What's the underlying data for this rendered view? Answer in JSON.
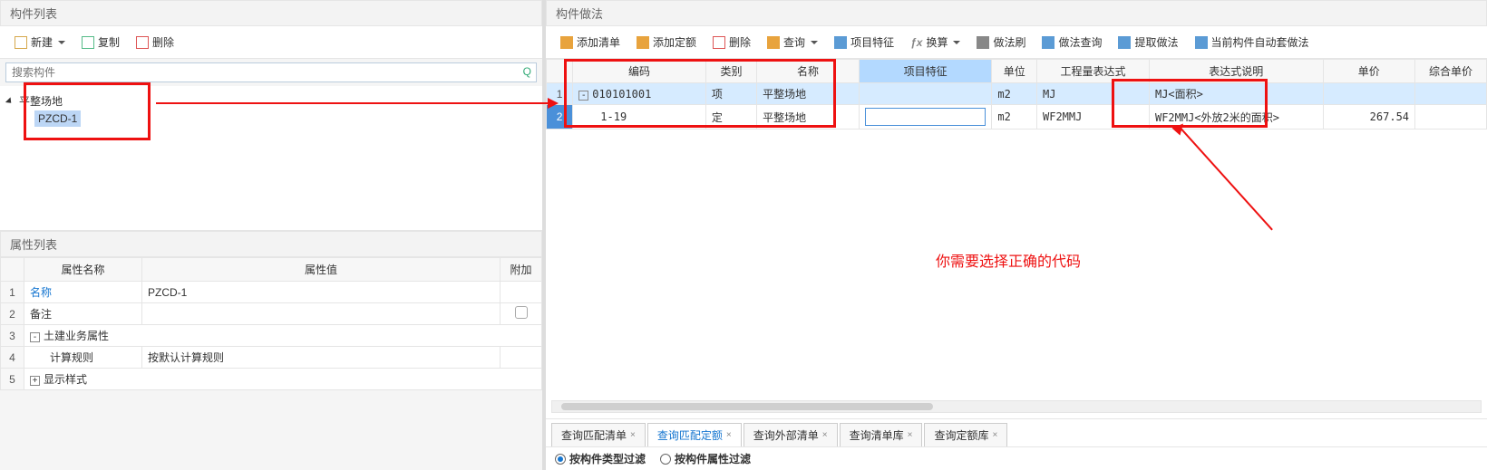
{
  "left": {
    "title": "构件列表",
    "toolbar": {
      "new": "新建",
      "copy": "复制",
      "delete": "删除"
    },
    "search_placeholder": "搜索构件",
    "tree": {
      "root": "平整场地",
      "child": "PZCD-1"
    },
    "attr_title": "属性列表",
    "attr_headers": {
      "name": "属性名称",
      "value": "属性值",
      "extra": "附加"
    },
    "attr_rows": [
      {
        "n": "1",
        "name": "名称",
        "value": "PZCD-1",
        "blue": true
      },
      {
        "n": "2",
        "name": "备注",
        "value": "",
        "check": true
      },
      {
        "n": "3",
        "name": "土建业务属性",
        "exp": "-",
        "span": true
      },
      {
        "n": "4",
        "name": "计算规则",
        "value": "按默认计算规则",
        "indent": true
      },
      {
        "n": "5",
        "name": "显示样式",
        "exp": "+",
        "span": true
      }
    ]
  },
  "right": {
    "title": "构件做法",
    "toolbar": {
      "add_list": "添加清单",
      "add_quota": "添加定额",
      "delete": "删除",
      "query": "查询",
      "proj_feature": "项目特征",
      "fx": "ƒx",
      "convert": "换算",
      "brush": "做法刷",
      "method_query": "做法查询",
      "extract": "提取做法",
      "auto": "当前构件自动套做法"
    },
    "headers": {
      "code": "编码",
      "type": "类别",
      "name": "名称",
      "feature": "项目特征",
      "unit": "单位",
      "expr": "工程量表达式",
      "expr_desc": "表达式说明",
      "price": "单价",
      "comp_price": "综合单价"
    },
    "rows": [
      {
        "n": "1",
        "code": "010101001",
        "type": "项",
        "name": "平整场地",
        "feature": "",
        "unit": "m2",
        "expr": "MJ",
        "desc": "MJ<面积>",
        "price": ""
      },
      {
        "n": "2",
        "code": "1-19",
        "type": "定",
        "name": "平整场地",
        "feature": "",
        "unit": "m2",
        "expr": "WF2MMJ",
        "desc": "WF2MMJ<外放2米的面积>",
        "price": "267.54"
      }
    ],
    "annotation": "你需要选择正确的代码",
    "tabs": [
      {
        "label": "查询匹配清单",
        "active": false
      },
      {
        "label": "查询匹配定额",
        "active": true
      },
      {
        "label": "查询外部清单",
        "active": false
      },
      {
        "label": "查询清单库",
        "active": false
      },
      {
        "label": "查询定额库",
        "active": false
      }
    ],
    "filters": {
      "by_type": "按构件类型过滤",
      "by_attr": "按构件属性过滤"
    }
  }
}
